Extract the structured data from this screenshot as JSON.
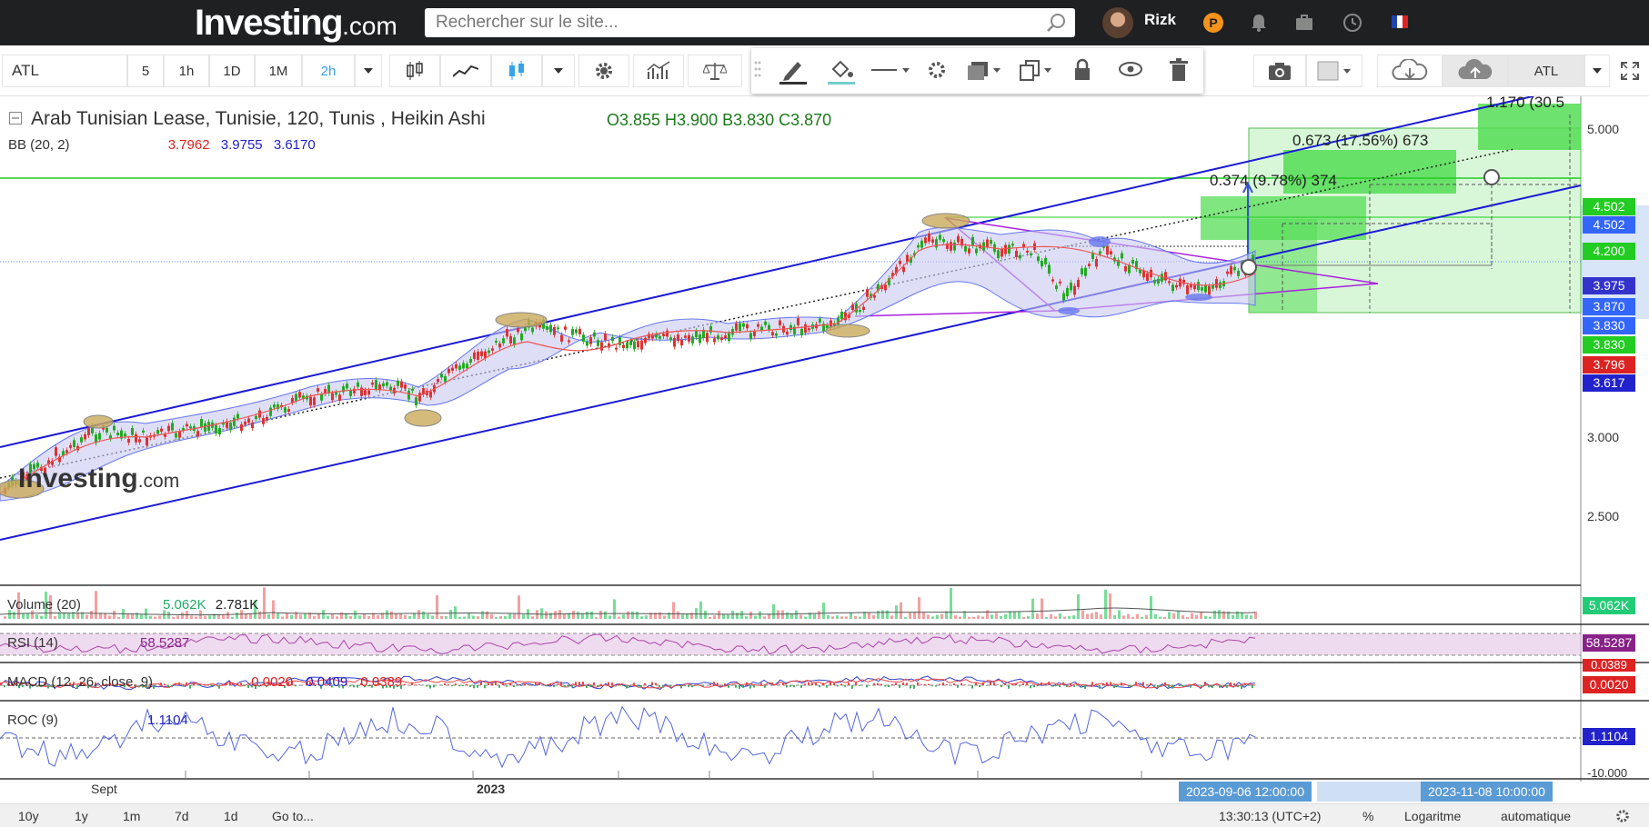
{
  "header": {
    "logo_main": "Investing",
    "logo_suffix": ".com",
    "search_placeholder": "Rechercher sur le site...",
    "username": "Rizk"
  },
  "toolbar": {
    "symbol": "ATL",
    "intervals": [
      "5",
      "1h",
      "1D",
      "1M",
      "2h"
    ],
    "active_interval": "2h",
    "compare_symbol": "ATL"
  },
  "chart": {
    "title": "Arab Tunisian Lease, Tunisie, 120, Tunis , Heikin Ashi",
    "ohlc": "O3.855  H3.900  B3.830  C3.870",
    "bb_label": "BB (20, 2)",
    "bb_values": [
      "3.7962",
      "3.9755",
      "3.6170"
    ],
    "annotations": [
      "0.374 (9.78%) 374",
      "0.673 (17.56%) 673",
      "1.170 (30.5"
    ],
    "watermark": "Investing",
    "watermark_suffix": ".com"
  },
  "price_axis": {
    "ticks": [
      "5.000",
      "3.000",
      "2.500"
    ],
    "labels": [
      {
        "text": "4.502",
        "color": "#22cc22"
      },
      {
        "text": "4.502",
        "color": "#3366ff"
      },
      {
        "text": "4.200",
        "color": "#22cc22"
      },
      {
        "text": "3.975",
        "color": "#3333cc"
      },
      {
        "text": "3.870",
        "color": "#3366ff"
      },
      {
        "text": "3.830",
        "color": "#3366ff"
      },
      {
        "text": "3.830",
        "color": "#22cc22"
      },
      {
        "text": "3.796",
        "color": "#dd2222"
      },
      {
        "text": "3.617",
        "color": "#2222cc"
      }
    ]
  },
  "panes": {
    "volume": {
      "label": "Volume (20)",
      "v1": "5.062K",
      "v2": "2.781K",
      "axis": "5.062K"
    },
    "rsi": {
      "label": "RSI (14)",
      "value": "58.5287",
      "axis": "58.5287"
    },
    "macd": {
      "label": "MACD (12, 26, close, 9)",
      "v1": "0.0020",
      "v2": "0.0409",
      "v3": "0.0389",
      "axis1": "0.0389",
      "axis2": "0.0020"
    },
    "roc": {
      "label": "ROC (9)",
      "value": "1.1104",
      "axis": "1.1104",
      "axis_low": "-10.000"
    }
  },
  "time_axis": {
    "labels": [
      "Sept",
      "2023"
    ],
    "range_start": "2023-09-06 12:00:00",
    "range_end": "2023-11-08 10:00:00"
  },
  "bottombar": {
    "ranges": [
      "10y",
      "1y",
      "1m",
      "7d",
      "1d"
    ],
    "goto": "Go to...",
    "clock": "13:30:13 (UTC+2)",
    "percent": "%",
    "log": "Logaritme",
    "auto": "automatique"
  }
}
